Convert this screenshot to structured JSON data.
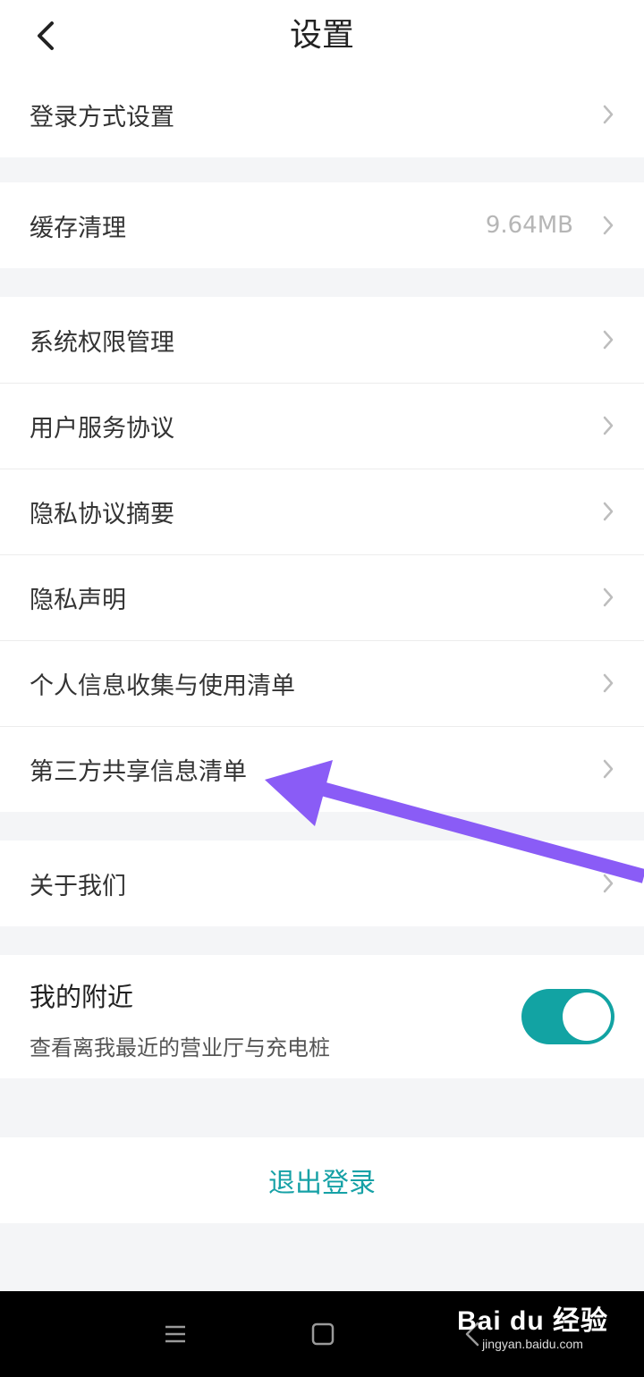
{
  "header": {
    "title": "设置"
  },
  "groups": [
    {
      "items": [
        {
          "label": "登录方式设置"
        }
      ]
    },
    {
      "items": [
        {
          "label": "缓存清理",
          "value": "9.64MB"
        }
      ]
    },
    {
      "items": [
        {
          "label": "系统权限管理"
        },
        {
          "label": "用户服务协议"
        },
        {
          "label": "隐私协议摘要"
        },
        {
          "label": "隐私声明"
        },
        {
          "label": "个人信息收集与使用清单"
        },
        {
          "label": "第三方共享信息清单"
        }
      ]
    },
    {
      "items": [
        {
          "label": "关于我们"
        }
      ]
    }
  ],
  "nearby": {
    "title": "我的附近",
    "description": "查看离我最近的营业厅与充电桩",
    "enabled": true,
    "toggle_color": "#12a3a3"
  },
  "logout": {
    "label": "退出登录",
    "color": "#16a1a6"
  },
  "nav_bar": {
    "icons": [
      "menu-icon",
      "home-square-icon",
      "back-triangle-icon"
    ]
  },
  "watermark": {
    "brand": "Bai du 经验",
    "url": "jingyan.baidu.com"
  },
  "annotation": {
    "type": "arrow",
    "color": "#8a5cf6",
    "points_to": "第三方共享信息清单"
  }
}
